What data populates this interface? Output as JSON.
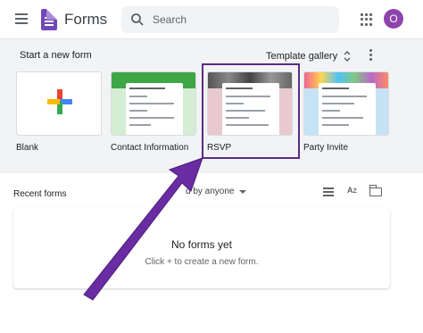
{
  "header": {
    "app_title": "Forms",
    "search_placeholder": "Search",
    "avatar_letter": "O",
    "icons": [
      "menu-icon",
      "forms-logo-icon",
      "search-icon",
      "apps-grid-icon"
    ]
  },
  "templates": {
    "heading": "Start a new form",
    "gallery_label": "Template gallery",
    "items": [
      {
        "label": "Blank"
      },
      {
        "label": "Contact Information"
      },
      {
        "label": "RSVP"
      },
      {
        "label": "Party Invite"
      }
    ]
  },
  "recent": {
    "heading": "Recent forms",
    "owner_filter": "d by anyone",
    "empty_title": "No forms yet",
    "empty_hint": "Click + to create a new form."
  },
  "colors": {
    "accent": "#7248b9",
    "annotation": "#5b2a86",
    "contact_green": "#3ea644",
    "rsvp_pink": "#e8c9cf",
    "party_blue": "#c6e3f5"
  }
}
